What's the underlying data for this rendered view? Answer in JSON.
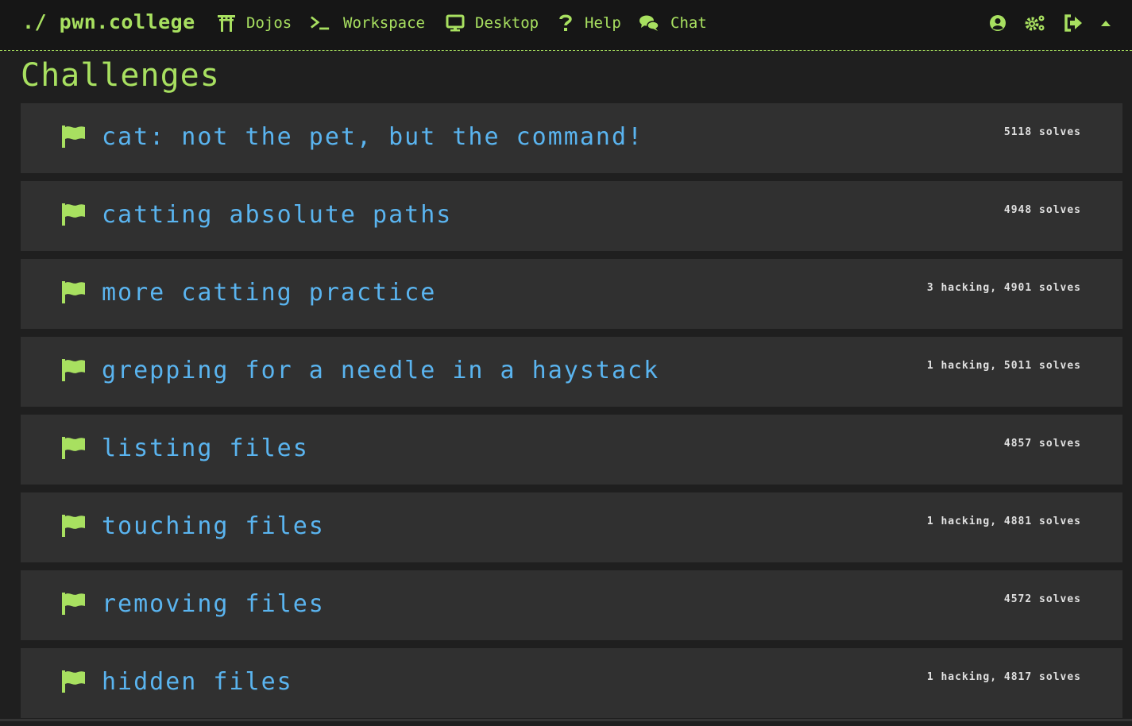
{
  "navbar": {
    "brand": "./ pwn.college",
    "items": [
      {
        "label": "Dojos",
        "icon": "torii-gate-icon"
      },
      {
        "label": "Workspace",
        "icon": "terminal-icon"
      },
      {
        "label": "Desktop",
        "icon": "desktop-icon"
      },
      {
        "label": "Help",
        "icon": "question-icon"
      },
      {
        "label": "Chat",
        "icon": "chat-bubbles-icon"
      }
    ],
    "right_icons": [
      "user-circle-icon",
      "cogs-icon",
      "logout-icon",
      "caret-up-icon"
    ]
  },
  "page": {
    "title": "Challenges"
  },
  "challenges": [
    {
      "name": "cat: not the pet, but the command!",
      "stats": "5118 solves"
    },
    {
      "name": "catting absolute paths",
      "stats": "4948 solves"
    },
    {
      "name": "more catting practice",
      "stats": "3 hacking, 4901 solves"
    },
    {
      "name": "grepping for a needle in a haystack",
      "stats": "1 hacking, 5011 solves"
    },
    {
      "name": "listing files",
      "stats": "4857 solves"
    },
    {
      "name": "touching files",
      "stats": "1 hacking, 4881 solves"
    },
    {
      "name": "removing files",
      "stats": "4572 solves"
    },
    {
      "name": "hidden files",
      "stats": "1 hacking, 4817 solves"
    }
  ],
  "colors": {
    "accent": "#a8e060",
    "link": "#5ab4ef",
    "background": "#1f1f1f",
    "card": "#303030",
    "navbar": "#161616",
    "flag": "#a8e060"
  }
}
